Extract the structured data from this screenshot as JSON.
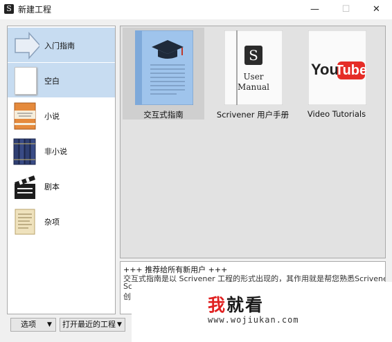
{
  "window": {
    "title": "新建工程",
    "app_icon": "S",
    "minimize_symbol": "—",
    "maximize_symbol": "☐",
    "close_symbol": "✕"
  },
  "sidebar": {
    "selected": "入门指南",
    "items": [
      {
        "label": "入门指南",
        "icon": "arrow-icon",
        "selected": true
      },
      {
        "label": "空白",
        "icon": "blank-page-icon",
        "selected": true
      },
      {
        "label": "小说",
        "icon": "novel-book-icon",
        "selected": false
      },
      {
        "label": "非小说",
        "icon": "books-icon",
        "selected": false
      },
      {
        "label": "剧本",
        "icon": "clapperboard-icon",
        "selected": false
      },
      {
        "label": "杂项",
        "icon": "parchment-icon",
        "selected": false
      }
    ]
  },
  "templates": [
    {
      "caption": "交互式指南",
      "icon": "graduation-cap-icon",
      "selected": true
    },
    {
      "caption": "Scrivener 用户手册",
      "icon": "user-manual-icon",
      "manual_text_1": "User",
      "manual_text_2": "Manual",
      "selected": false
    },
    {
      "caption": "Video Tutorials",
      "icon": "youtube-icon",
      "yt_you": "You",
      "yt_tube": "Tube",
      "selected": false
    }
  ],
  "description": {
    "line1": "+++ 推荐给所有新用户 +++",
    "line2": "交互式指南是以 Scrivener 工程的形式出现的，其作用就是帮您熟悉Scrivener的用户界面",
    "line3": "Sc",
    "line4": "创"
  },
  "watermark": {
    "big_red": "我",
    "big_black": "就看",
    "url": "www.wojiukan.com"
  },
  "footer": {
    "options_label": "选项",
    "recent_label": "打开最近的工程"
  },
  "colors": {
    "selection_blue": "#c7dcf1",
    "tile_selected": "#cfcfcf",
    "youtube_red": "#e52d27",
    "watermark_red": "#e02020"
  }
}
